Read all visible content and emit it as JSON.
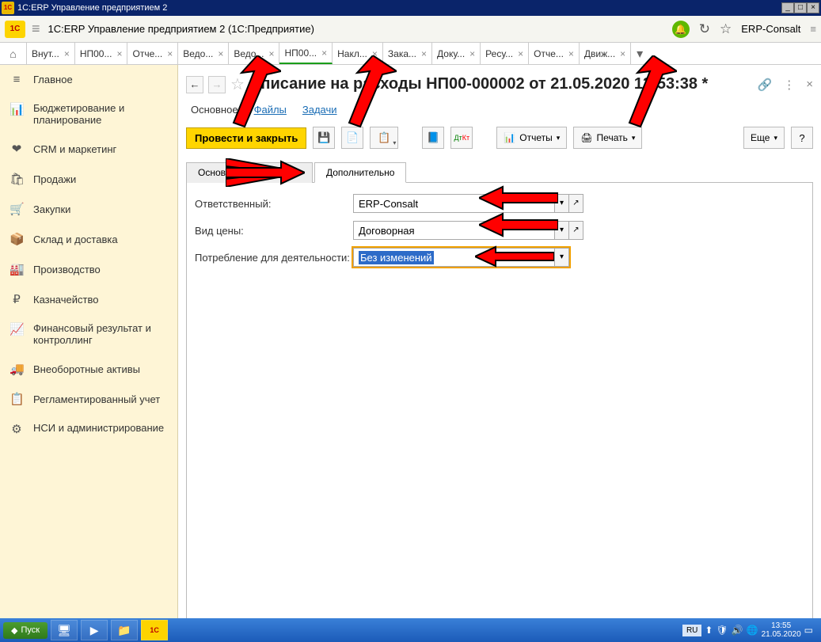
{
  "window_title": "1С:ERP Управление предприятием 2",
  "header_title": "1С:ERP Управление предприятием 2  (1С:Предприятие)",
  "header_user": "ERP-Consalt",
  "tabs": [
    {
      "label": "Внут..."
    },
    {
      "label": "НП00..."
    },
    {
      "label": "Отче..."
    },
    {
      "label": "Ведо..."
    },
    {
      "label": "Ведо..."
    },
    {
      "label": "НП00..."
    },
    {
      "label": "Накл..."
    },
    {
      "label": "Зака..."
    },
    {
      "label": "Доку..."
    },
    {
      "label": "Ресу..."
    },
    {
      "label": "Отче..."
    },
    {
      "label": "Движ..."
    }
  ],
  "active_tab_index": 5,
  "sidebar": [
    {
      "icon": "≡",
      "label": "Главное"
    },
    {
      "icon": "📊",
      "label": "Бюджетирование и планирование"
    },
    {
      "icon": "❤",
      "label": "CRM и маркетинг"
    },
    {
      "icon": "🛍",
      "label": "Продажи"
    },
    {
      "icon": "🛒",
      "label": "Закупки"
    },
    {
      "icon": "📦",
      "label": "Склад и доставка"
    },
    {
      "icon": "🏭",
      "label": "Производство"
    },
    {
      "icon": "₽",
      "label": "Казначейство"
    },
    {
      "icon": "📈",
      "label": "Финансовый результат и контроллинг"
    },
    {
      "icon": "🚚",
      "label": "Внеоборотные активы"
    },
    {
      "icon": "📋",
      "label": "Регламентированный учет"
    },
    {
      "icon": "⚙",
      "label": "НСИ и администрирование"
    }
  ],
  "doc": {
    "title": "Списание на расходы НП00-000002 от 21.05.2020 13:53:38 *",
    "sublinks": {
      "main": "Основное",
      "files": "Файлы",
      "tasks": "Задачи"
    },
    "toolbar": {
      "post_close": "Провести и закрыть",
      "reports": "Отчеты",
      "print": "Печать",
      "more": "Еще",
      "help": "?"
    },
    "form_tabs": {
      "t1": "Основное",
      "t2": "Дополнительно"
    },
    "active_form_tab": 1,
    "fields": {
      "responsible": {
        "label": "Ответственный:",
        "value": "ERP-Consalt"
      },
      "price_type": {
        "label": "Вид цены:",
        "value": "Договорная"
      },
      "consumption": {
        "label": "Потребление для деятельности:",
        "value": "Без изменений"
      }
    }
  },
  "taskbar": {
    "start": "Пуск",
    "lang": "RU",
    "time": "13:55",
    "date": "21.05.2020"
  }
}
